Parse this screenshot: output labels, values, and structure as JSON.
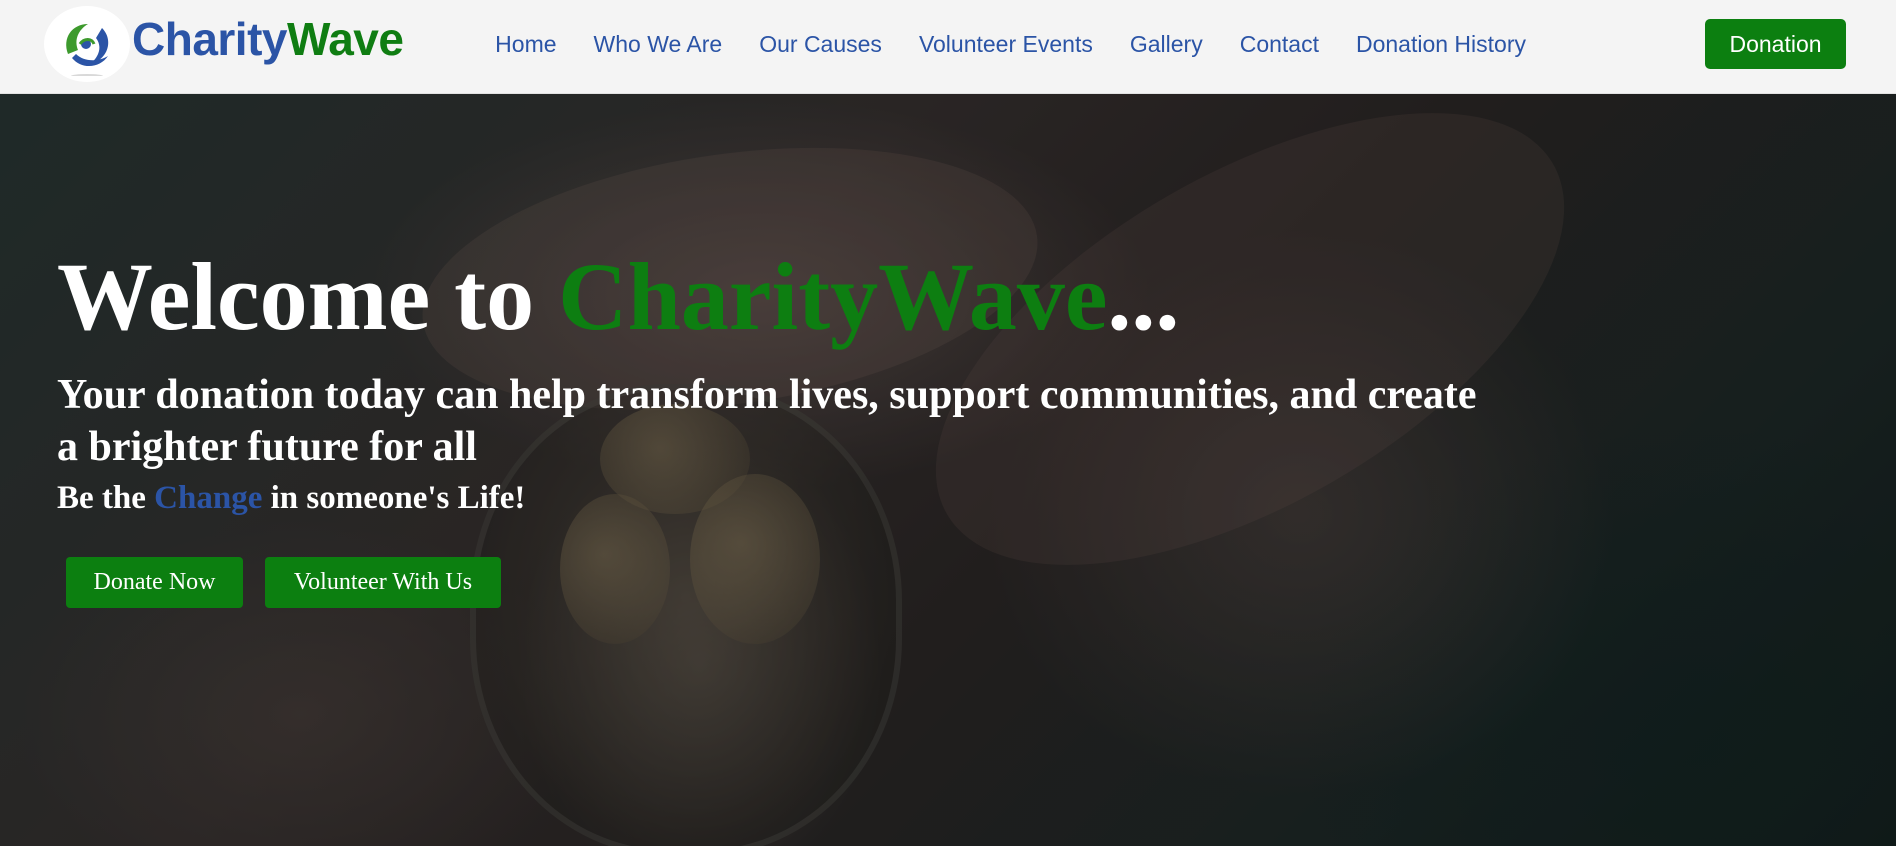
{
  "brand": {
    "name_part1": "Charity",
    "name_part2": "Wave",
    "logo_icon": "charitywave-logo-icon",
    "colors": {
      "primary_blue": "#2b54a6",
      "primary_green": "#0c7f10"
    }
  },
  "nav": {
    "items": [
      {
        "label": "Home"
      },
      {
        "label": "Who We Are"
      },
      {
        "label": "Our Causes"
      },
      {
        "label": "Volunteer Events"
      },
      {
        "label": "Gallery"
      },
      {
        "label": "Contact"
      },
      {
        "label": "Donation History"
      }
    ],
    "donation_button": "Donation"
  },
  "hero": {
    "title_prefix": "Welcome to ",
    "title_highlight": "CharityWave",
    "title_suffix": "...",
    "subtitle": "Your donation today can help transform lives, support communities, and create a brighter future for all",
    "tagline_prefix": "Be the ",
    "tagline_highlight": "Change",
    "tagline_suffix": " in someone's Life!",
    "buttons": {
      "donate_now": "Donate Now",
      "volunteer": "Volunteer With Us"
    }
  }
}
